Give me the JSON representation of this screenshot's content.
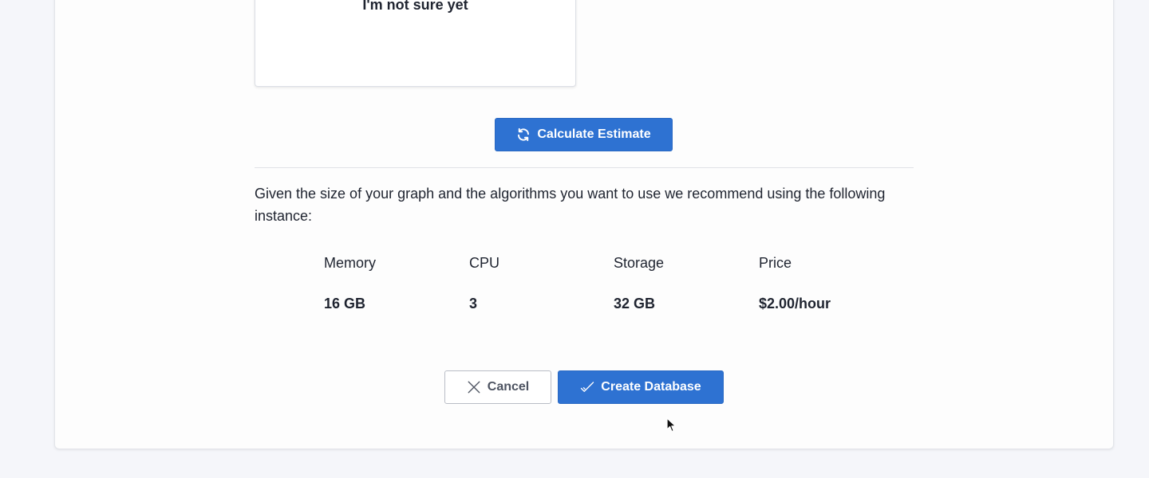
{
  "option_card": {
    "title": "I'm not sure yet"
  },
  "calculate_button": {
    "label": "Calculate Estimate",
    "icon": "refresh-icon"
  },
  "recommendation": {
    "text": "Given the size of your graph and the algorithms you want to use we recommend using the following instance:"
  },
  "specs": [
    {
      "label": "Memory",
      "value": "16 GB"
    },
    {
      "label": "CPU",
      "value": "3"
    },
    {
      "label": "Storage",
      "value": "32 GB"
    },
    {
      "label": "Price",
      "value": "$2.00/hour"
    }
  ],
  "actions": {
    "cancel_label": "Cancel",
    "cancel_icon": "close-icon",
    "create_label": "Create Database",
    "create_icon": "checkmark-icon"
  },
  "colors": {
    "primary": "#2e72d2",
    "background": "#f5f6fa",
    "card": "#fdfdfd"
  }
}
